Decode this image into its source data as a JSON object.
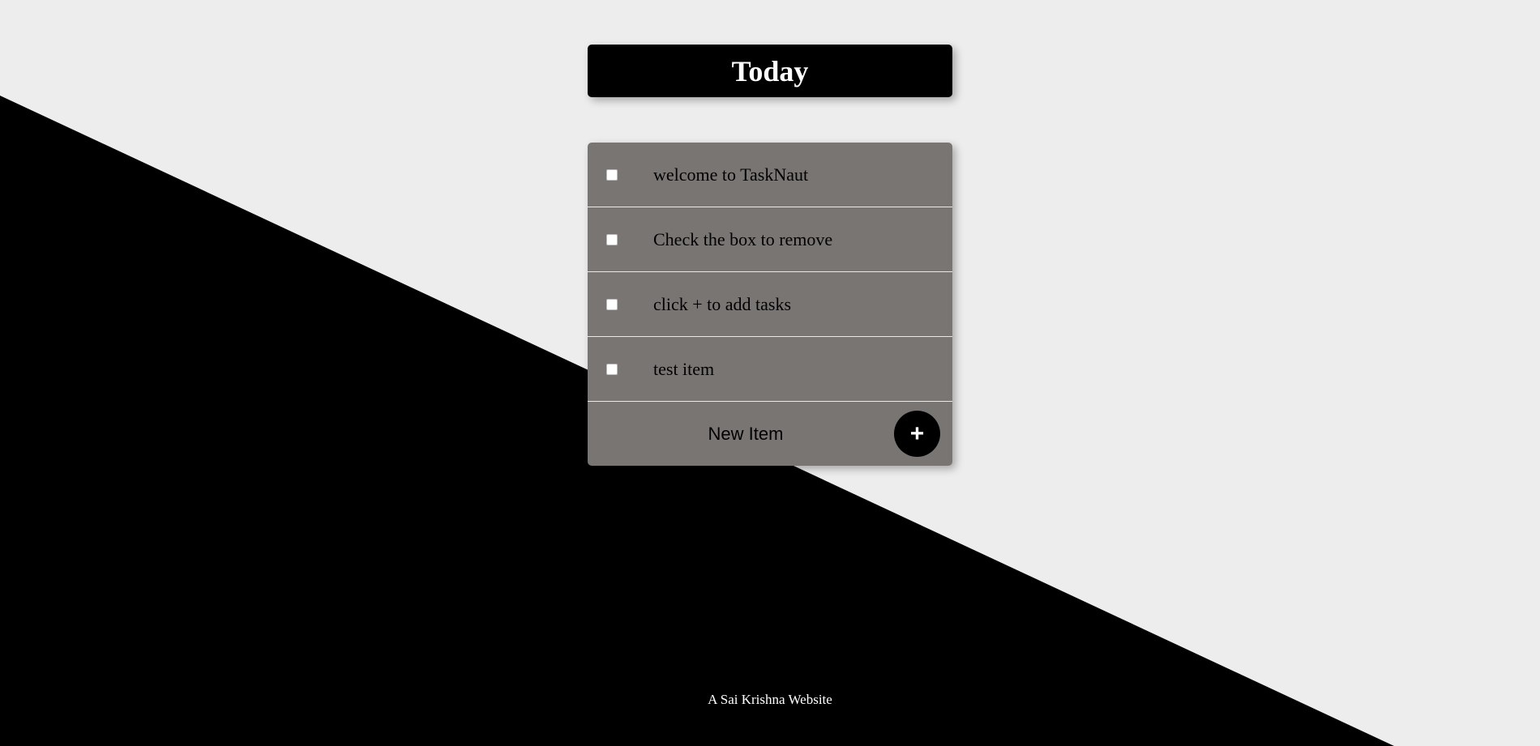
{
  "app": {
    "title": "Today"
  },
  "tasks": [
    {
      "label": "welcome to TaskNaut",
      "checked": false
    },
    {
      "label": "Check the box to remove",
      "checked": false
    },
    {
      "label": "click + to add tasks",
      "checked": false
    },
    {
      "label": "test item",
      "checked": false
    }
  ],
  "new_item": {
    "placeholder": "New Item",
    "value": ""
  },
  "add_button": {
    "label": "+"
  },
  "footer": {
    "text": "A Sai Krishna Website"
  },
  "colors": {
    "background_light": "#ededed",
    "background_dark": "#000000",
    "header_bg": "#000000",
    "list_bg": "#797573",
    "divider": "#e8e8e8",
    "button_bg": "#000000",
    "text_light": "#ffffff"
  }
}
